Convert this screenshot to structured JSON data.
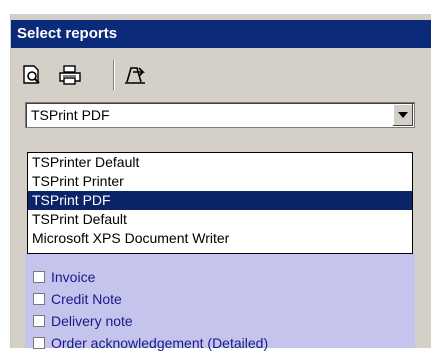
{
  "panel": {
    "title": "Select reports"
  },
  "toolbar": {
    "icons": [
      "print-preview-icon",
      "printer-icon",
      "export-icon"
    ]
  },
  "printer_select": {
    "value": "TSPrint PDF"
  },
  "dropdown": {
    "options": [
      "TSPrinter Default",
      "TSPrint Printer",
      "TSPrint PDF",
      "TSPrint Default",
      "Microsoft XPS Document Writer"
    ],
    "selected_index": 2
  },
  "reports": {
    "items": [
      "Invoice",
      "Credit Note",
      "Delivery note",
      "Order acknowledgement (Detailed)"
    ]
  },
  "colors": {
    "title_bg": "#0b2a7a",
    "selected_bg": "#0a246a",
    "list_bg": "#c4c4ec",
    "list_text": "#1a1a8a"
  }
}
